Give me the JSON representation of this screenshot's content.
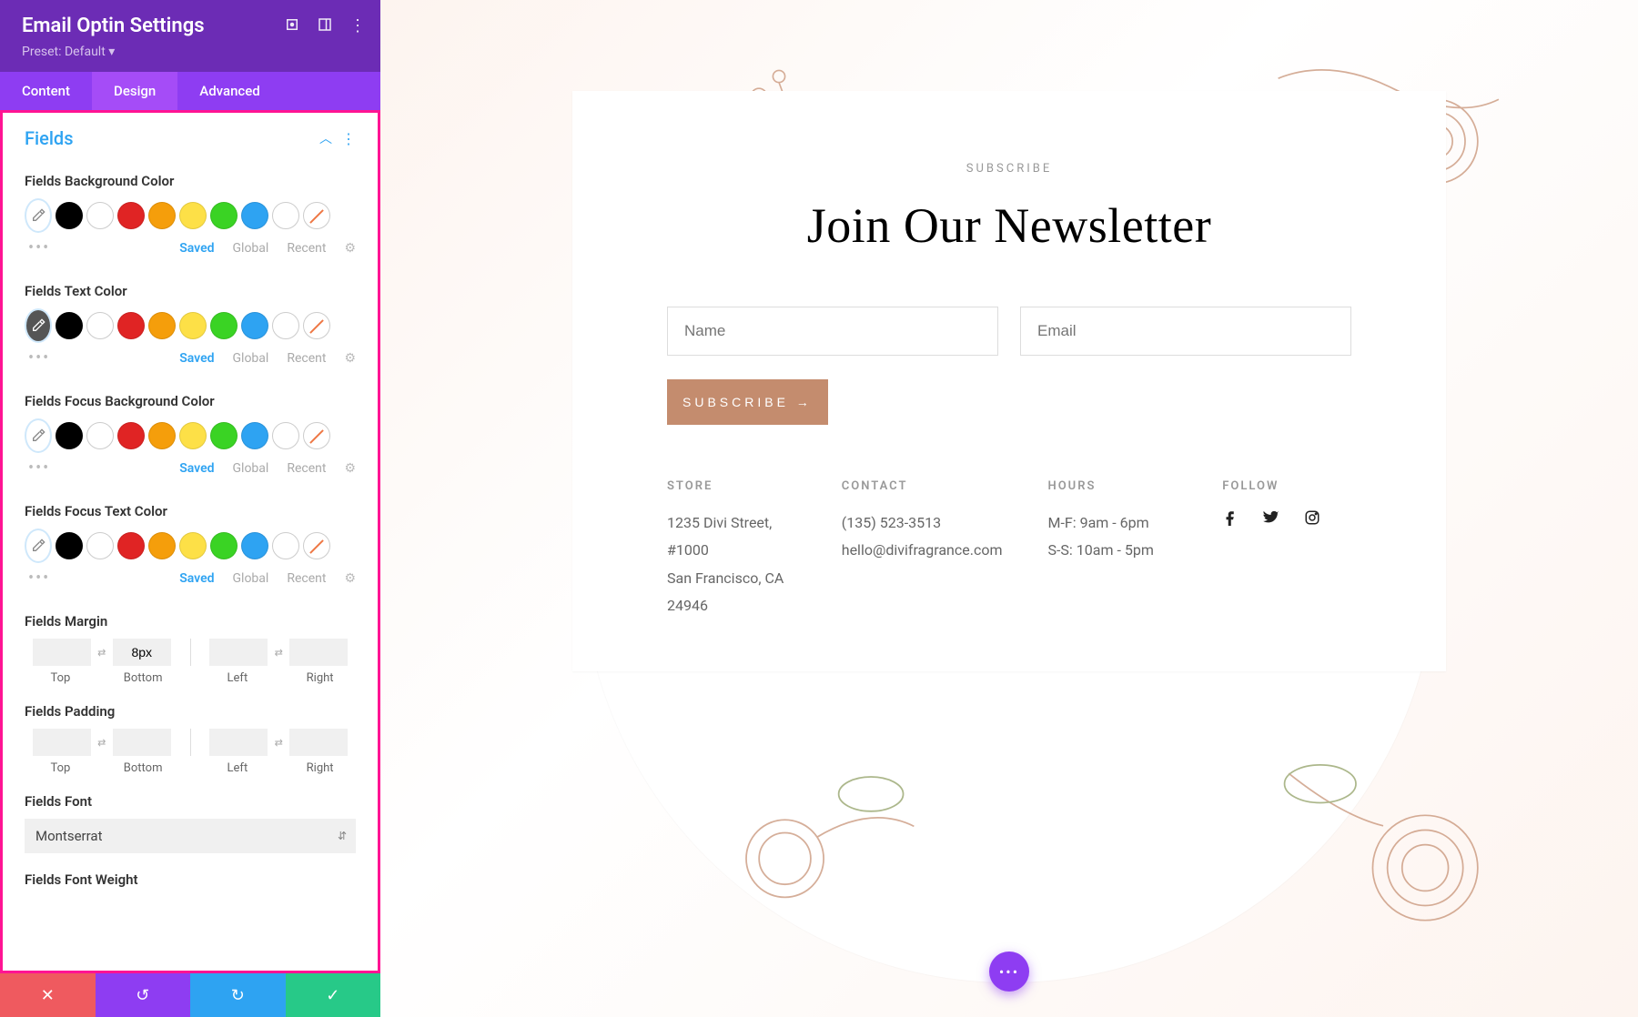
{
  "panel": {
    "title": "Email Optin Settings",
    "preset_prefix": "Preset:",
    "preset_value": "Default"
  },
  "tabs": {
    "content": "Content",
    "design": "Design",
    "advanced": "Advanced"
  },
  "section": {
    "name": "Fields"
  },
  "color_groups": [
    {
      "label": "Fields Background Color",
      "picker_variant": "light"
    },
    {
      "label": "Fields Text Color",
      "picker_variant": "dark"
    },
    {
      "label": "Fields Focus Background Color",
      "picker_variant": "light"
    },
    {
      "label": "Fields Focus Text Color",
      "picker_variant": "light"
    }
  ],
  "palette_colors": [
    "#000000",
    "#ffffff",
    "#e02424",
    "#f59e0b",
    "#fde047",
    "#3ad324",
    "#2ea3f2",
    "#ffffff"
  ],
  "palette_tabs": {
    "saved": "Saved",
    "global": "Global",
    "recent": "Recent"
  },
  "margin": {
    "label": "Fields Margin",
    "bottom_val": "8px",
    "subs": [
      "Top",
      "Bottom",
      "Left",
      "Right"
    ]
  },
  "padding": {
    "label": "Fields Padding",
    "subs": [
      "Top",
      "Bottom",
      "Left",
      "Right"
    ]
  },
  "font": {
    "label": "Fields Font",
    "value": "Montserrat"
  },
  "weight": {
    "label": "Fields Font Weight"
  },
  "preview": {
    "eyebrow": "SUBSCRIBE",
    "headline": "Join Our Newsletter",
    "name_placeholder": "Name",
    "email_placeholder": "Email",
    "button": "SUBSCRIBE →",
    "cols": {
      "store": {
        "h": "STORE",
        "l1": "1235 Divi Street, #1000",
        "l2": "San Francisco, CA 24946"
      },
      "contact": {
        "h": "CONTACT",
        "l1": "(135) 523-3513",
        "l2": "hello@divifragrance.com"
      },
      "hours": {
        "h": "HOURS",
        "l1": "M-F: 9am - 6pm",
        "l2": "S-S: 10am - 5pm"
      },
      "follow": {
        "h": "FOLLOW"
      }
    }
  },
  "theme": {
    "accent": "#c48c6e",
    "purple": "#8e3df2"
  }
}
